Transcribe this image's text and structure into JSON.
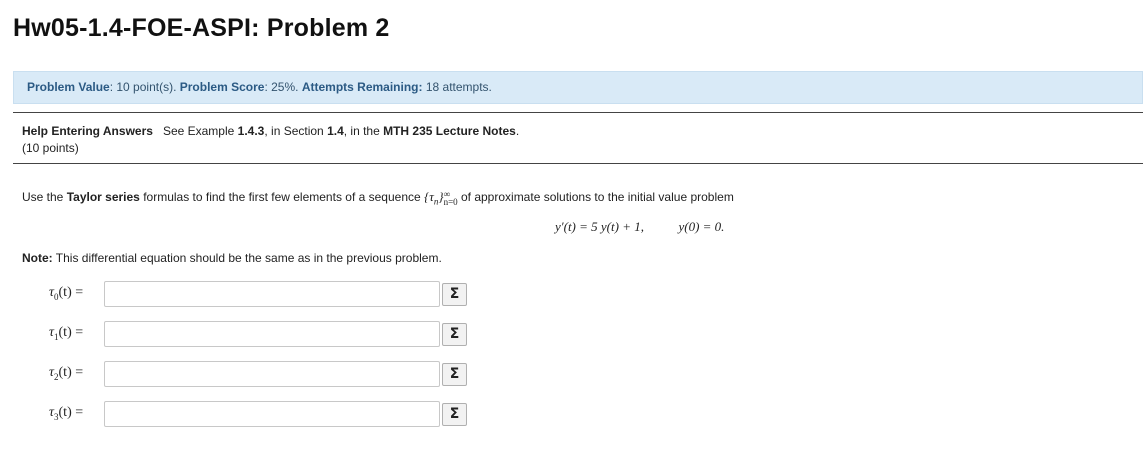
{
  "page": {
    "title": "Hw05-1.4-FOE-ASPI: Problem 2"
  },
  "status_bar": {
    "value_label": "Problem Value",
    "value_text": ": 10 point(s).",
    "score_label": "Problem Score",
    "score_text": ": 25%.",
    "attempts_label": "Attempts Remaining:",
    "attempts_text": "18 attempts."
  },
  "help": {
    "label": "Help Entering Answers",
    "text_1": "See Example ",
    "example": "1.4.3",
    "text_2": ", in Section ",
    "section": "1.4",
    "text_3": ", in the ",
    "notes": "MTH 235 Lecture Notes",
    "text_4": ".",
    "points": "(10 points)"
  },
  "problem": {
    "text_before": "Use the ",
    "bold_term": "Taylor series",
    "text_after": " formulas to find the first few elements of a sequence ",
    "sequence": "{τ",
    "sequence_sub": "n",
    "sequence_close": "}",
    "sequence_sup": "∞",
    "sequence_lower": "n=0",
    "text_end": " of approximate solutions to the initial value problem",
    "equation": "y′(t) = 5 y(t) + 1,",
    "initial": "y(0) = 0."
  },
  "note": {
    "label": "Note:",
    "text": " This differential equation should be the same as in the previous problem."
  },
  "answers": [
    {
      "symbol": "τ",
      "index": "0",
      "arg": "(t) =",
      "value": "",
      "sigma": "Σ"
    },
    {
      "symbol": "τ",
      "index": "1",
      "arg": "(t) =",
      "value": "",
      "sigma": "Σ"
    },
    {
      "symbol": "τ",
      "index": "2",
      "arg": "(t) =",
      "value": "",
      "sigma": "Σ"
    },
    {
      "symbol": "τ",
      "index": "3",
      "arg": "(t) =",
      "value": "",
      "sigma": "Σ"
    }
  ]
}
